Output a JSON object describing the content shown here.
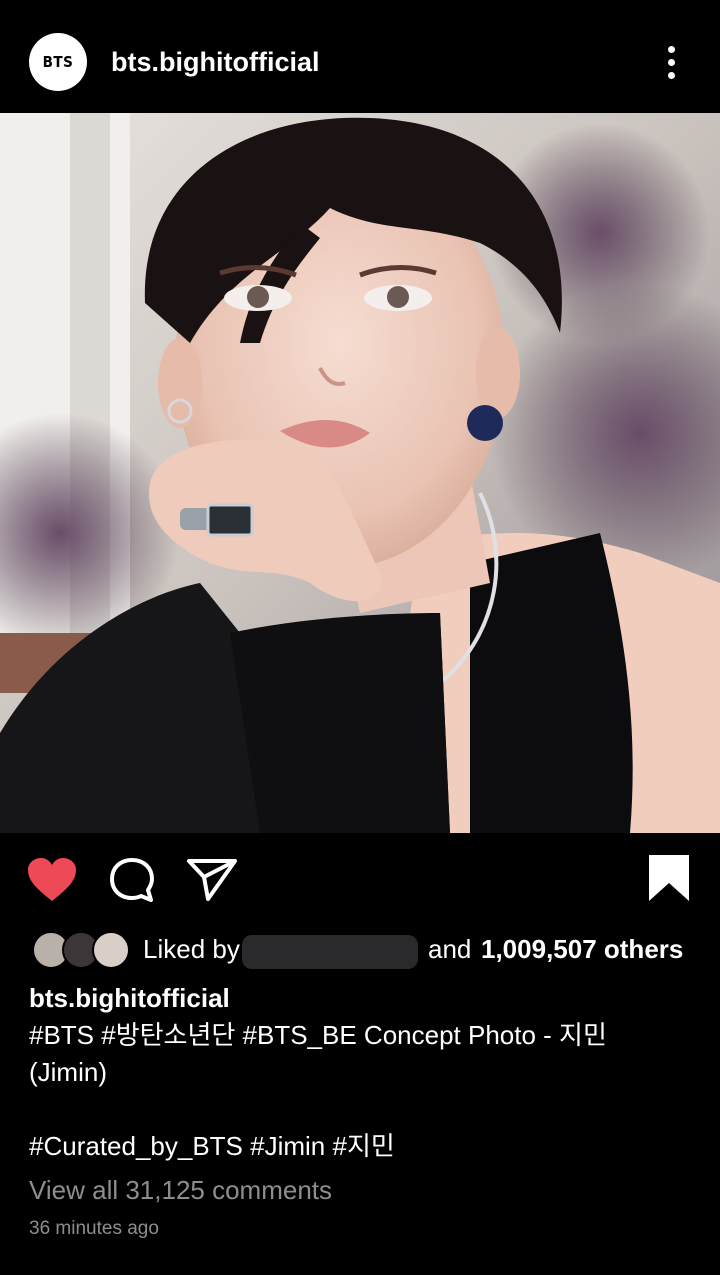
{
  "header": {
    "avatar_text": "BTS",
    "username": "bts.bighitofficial",
    "more_icon": "more-vertical-icon"
  },
  "post": {
    "image_alt": "BTS BE concept photo of Jimin"
  },
  "actions": {
    "like_icon": "heart-filled-icon",
    "comment_icon": "comment-icon",
    "share_icon": "send-icon",
    "save_icon": "bookmark-filled-icon",
    "like_color": "#ed4956"
  },
  "likes": {
    "prefix": "Liked by",
    "middle": "and",
    "count_text": "1,009,507 others"
  },
  "caption": {
    "username": "bts.bighitofficial",
    "line1": "#BTS #방탄소년단 #BTS_BE Concept Photo - 지민",
    "line2": "(Jimin)",
    "line3": "#Curated_by_BTS #Jimin #지민"
  },
  "comments_link": "View all 31,125 comments",
  "timestamp": "36 minutes ago"
}
